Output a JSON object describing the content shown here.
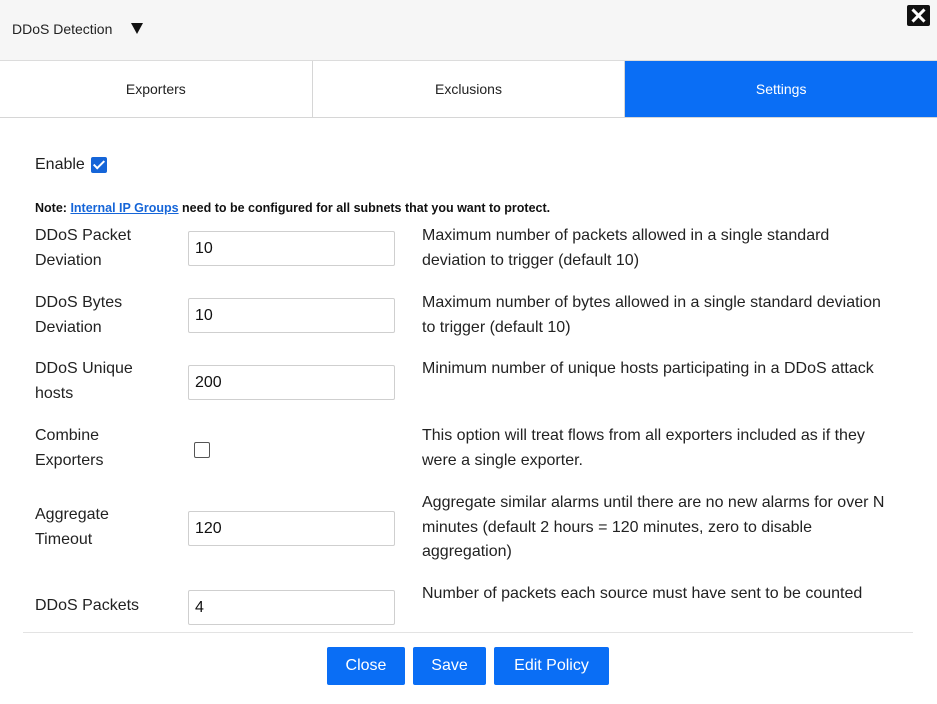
{
  "header": {
    "title": "DDoS Detection"
  },
  "tabs": [
    {
      "label": "Exporters",
      "active": false
    },
    {
      "label": "Exclusions",
      "active": false
    },
    {
      "label": "Settings",
      "active": true
    }
  ],
  "enable": {
    "label": "Enable",
    "checked": true
  },
  "note": {
    "prefix": "Note:",
    "link": "Internal IP Groups",
    "suffix": "need to be configured for all subnets that you want to protect."
  },
  "settings": [
    {
      "label": "DDoS Packet Deviation",
      "value": "10",
      "description": "Maximum number of packets allowed in a single standard deviation to trigger (default 10)"
    },
    {
      "label": "DDoS Bytes Deviation",
      "value": "10",
      "description": "Maximum number of bytes allowed in a single standard deviation to trigger (default 10)"
    },
    {
      "label": "DDoS Unique hosts",
      "value": "200",
      "description": "Minimum number of unique hosts participating in a DDoS attack"
    },
    {
      "label": "Combine Exporters",
      "checked": false,
      "description": "This option will treat flows from all exporters included as if they were a single exporter."
    },
    {
      "label": "Aggregate Timeout",
      "value": "120",
      "description": "Aggregate similar alarms until there are no new alarms for over N minutes (default 2 hours = 120 minutes, zero to disable aggregation)"
    },
    {
      "label": "DDoS Packets",
      "value": "4",
      "description": "Number of packets each source must have sent to be counted"
    }
  ],
  "buttons": {
    "close": "Close",
    "save": "Save",
    "edit_policy": "Edit Policy"
  },
  "colors": {
    "accent": "#0a6ef5",
    "link": "#1565d8"
  }
}
